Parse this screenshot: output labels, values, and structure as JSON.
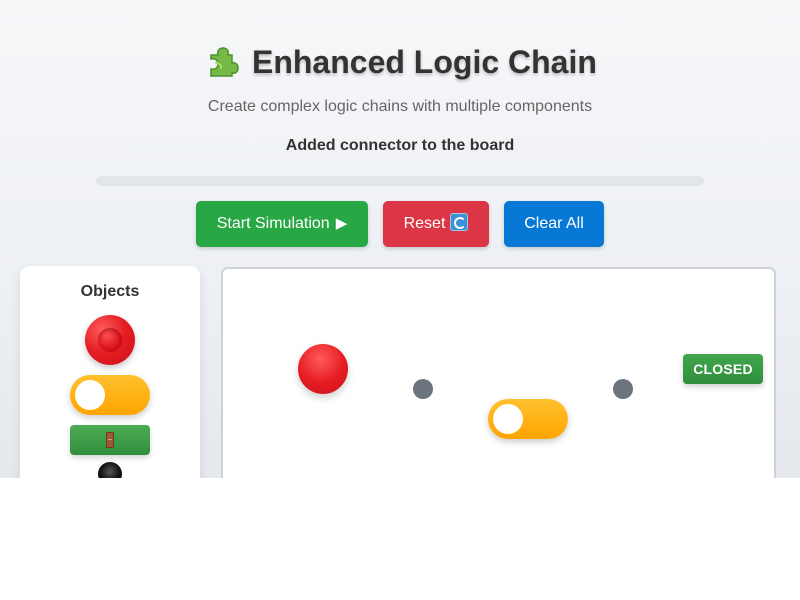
{
  "header": {
    "title": "Enhanced Logic Chain",
    "title_icon": "puzzle-piece-icon",
    "subtitle": "Create complex logic chains with multiple components",
    "status": "Added connector to the board"
  },
  "progress": {
    "value": 0
  },
  "toolbar": {
    "start_label": "Start Simulation",
    "start_glyph": "▶",
    "reset_label": "Reset",
    "reset_icon": "reset-icon",
    "clear_label": "Clear All"
  },
  "objects_panel": {
    "title": "Objects",
    "items": [
      {
        "name": "red-button-object",
        "icon": "red-button-icon"
      },
      {
        "name": "toggle-switch-object",
        "icon": "toggle-switch-icon"
      },
      {
        "name": "door-object",
        "icon": "door-icon"
      },
      {
        "name": "black-ball-object",
        "icon": "black-ball-icon"
      }
    ]
  },
  "board": {
    "badge": "CLOSED",
    "components": [
      {
        "type": "red-ball"
      },
      {
        "type": "connector"
      },
      {
        "type": "toggle-switch",
        "state": "off"
      },
      {
        "type": "connector"
      },
      {
        "type": "door",
        "state": "closed"
      }
    ]
  },
  "colors": {
    "start_button": "#28a745",
    "reset_button": "#dc3545",
    "clear_button": "#0878d7",
    "toggle": "#ffa400",
    "door_badge": "#2f8e3c",
    "connector": "#6c757d",
    "red_component": "#e51d22"
  }
}
